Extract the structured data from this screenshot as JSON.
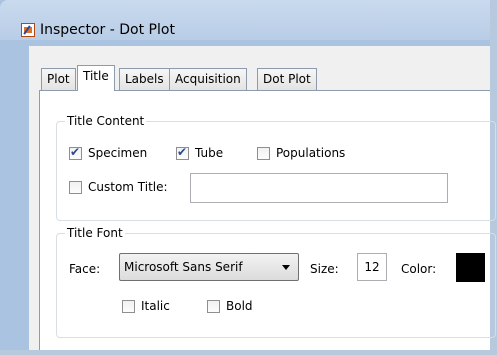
{
  "window": {
    "title": "Inspector - Dot Plot"
  },
  "tabs": [
    {
      "label": "Plot",
      "active": false
    },
    {
      "label": "Title",
      "active": true
    },
    {
      "label": "Labels",
      "active": false
    },
    {
      "label": "Acquisition",
      "active": false
    },
    {
      "label": "Dot Plot",
      "active": false
    }
  ],
  "title_content": {
    "heading": "Title Content",
    "specimen": {
      "label": "Specimen",
      "checked": true
    },
    "tube": {
      "label": "Tube",
      "checked": true
    },
    "populations": {
      "label": "Populations",
      "checked": false
    },
    "custom_title": {
      "label": "Custom Title:",
      "checked": false,
      "value": ""
    }
  },
  "title_font": {
    "heading": "Title Font",
    "face_label": "Face:",
    "face_value": "Microsoft Sans Serif",
    "size_label": "Size:",
    "size_value": "12",
    "color_label": "Color:",
    "color_value": "#000000",
    "italic": {
      "label": "Italic",
      "checked": false
    },
    "bold": {
      "label": "Bold",
      "checked": false
    }
  }
}
